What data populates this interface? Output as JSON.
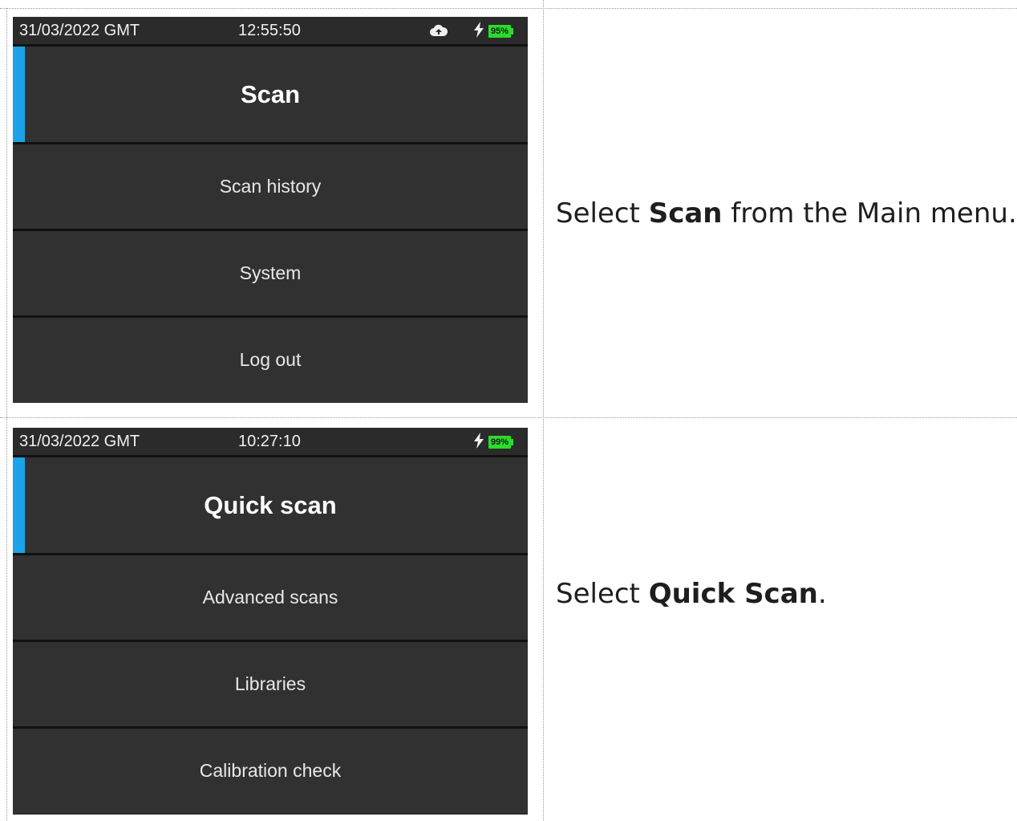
{
  "rows": [
    {
      "screen": {
        "date": "31/03/2022 GMT",
        "time": "12:55:50",
        "battery": "95%",
        "icons": [
          "cloud-icon",
          "charging-bolt-icon"
        ],
        "menu": [
          "Scan",
          "Scan history",
          "System",
          "Log out"
        ],
        "selected_index": 0
      },
      "instruction": {
        "pre": "Select ",
        "bold": "Scan",
        "post": " from the Main menu."
      }
    },
    {
      "screen": {
        "date": "31/03/2022 GMT",
        "time": "10:27:10",
        "battery": "99%",
        "icons": [
          "charging-bolt-icon"
        ],
        "menu": [
          "Quick scan",
          "Advanced scans",
          "Libraries",
          "Calibration check"
        ],
        "selected_index": 0
      },
      "instruction": {
        "pre": "Select ",
        "bold": "Quick Scan",
        "post": "."
      }
    }
  ],
  "colors": {
    "accent": "#1aa3e8",
    "battery": "#2bdc2b",
    "screen_bg": "#313131",
    "separator": "#111111"
  }
}
